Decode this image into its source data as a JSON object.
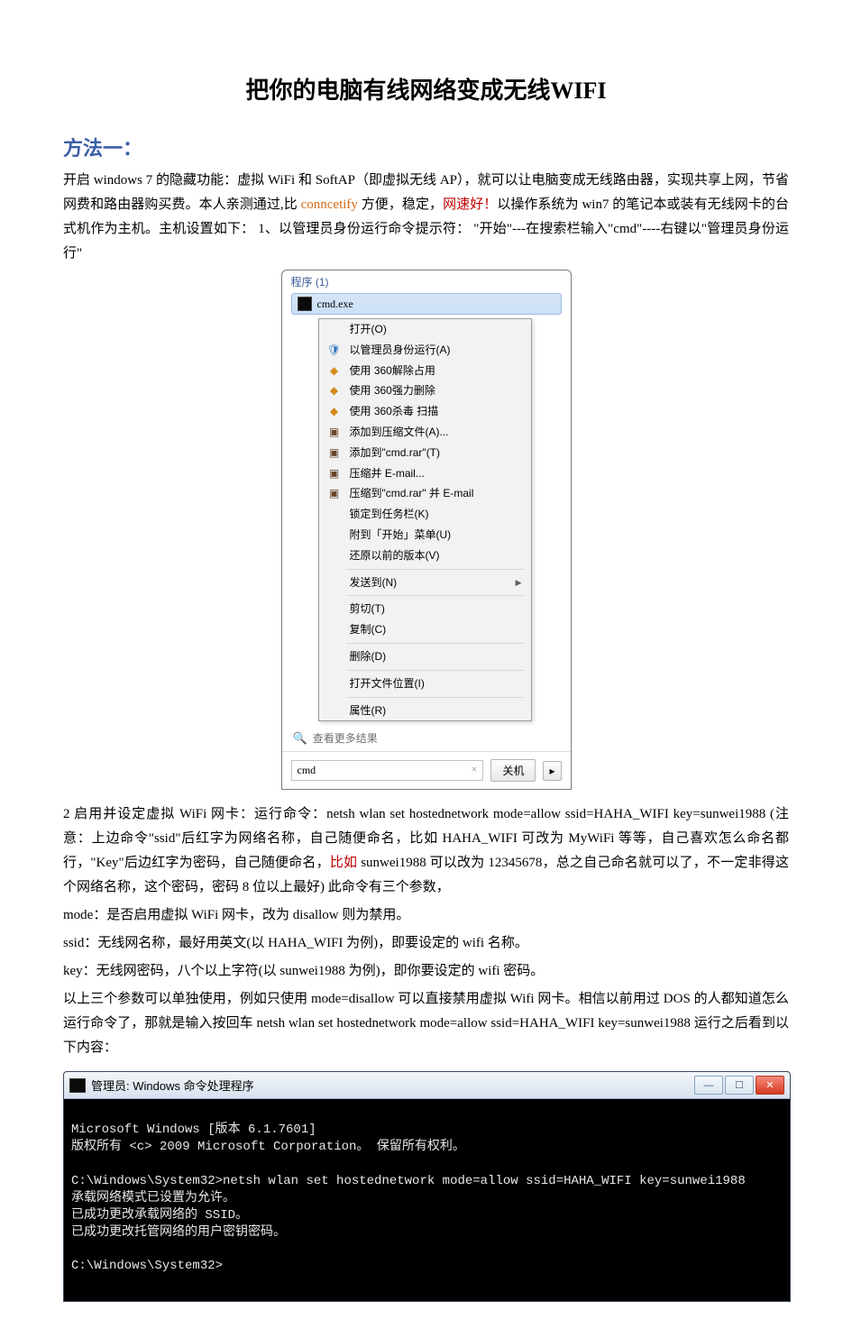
{
  "title": "把你的电脑有线网络变成无线WIFI",
  "section_heading": "方法一：",
  "para1_a": "开启 windows  7 的隐藏功能：虚拟 WiFi 和 SoftAP（即虚拟无线 AP），就可以让电脑变成无线路由器，实现共享上网，节省网费和路由器购买费。本人亲测通过,比 ",
  "para1_b": "conncetify",
  "para1_c": " 方便，稳定，",
  "para1_d": "网速好！",
  "para1_e": "以操作系统为 win7 的笔记本或装有无线网卡的台式机作为主机。主机设置如下：  1、以管理员身份运行命令提示符： \"开始\"---在搜索栏输入\"cmd\"----右键以\"管理员身份运行\"",
  "menu": {
    "header": "程序 (1)",
    "hit_label": "cmd.exe",
    "items": [
      "打开(O)",
      "以管理员身份运行(A)",
      "使用 360解除占用",
      "使用 360强力删除",
      "使用 360杀毒 扫描",
      "添加到压缩文件(A)...",
      "添加到\"cmd.rar\"(T)",
      "压缩并 E-mail...",
      "压缩到\"cmd.rar\" 并 E-mail",
      "锁定到任务栏(K)",
      "附到「开始」菜单(U)",
      "还原以前的版本(V)",
      "发送到(N)",
      "剪切(T)",
      "复制(C)",
      "删除(D)",
      "打开文件位置(I)",
      "属性(R)"
    ],
    "see_more": "查看更多结果",
    "search_value": "cmd",
    "shutdown": "关机"
  },
  "para2_a": "2 启用并设定虚拟 WiFi 网卡：运行命令：netsh  wlan  set  hostednetwork  mode=allow  ssid=HAHA_WIFI  key=sunwei1988    (注意：上边命令\"ssid\"后红字为网络名称，自己随便命名，比如 HAHA_WIFI 可改为 MyWiFi 等等，自己喜欢怎么命名都行，\"Key\"后边红字为密码，自己随便命名，",
  "para2_b": "比如",
  "para2_c": " sunwei1988 可以改为 12345678，总之自己命名就可以了，不一定非得这个网络名称，这个密码，密码 8 位以上最好)    此命令有三个参数，",
  "para3": "mode：是否启用虚拟 WiFi 网卡，改为 disallow 则为禁用。",
  "para4": "ssid：无线网名称，最好用英文(以 HAHA_WIFI 为例)，即要设定的 wifi 名称。",
  "para5": "key：无线网密码，八个以上字符(以 sunwei1988 为例)，即你要设定的 wifi 密码。",
  "para6": "以上三个参数可以单独使用，例如只使用 mode=disallow  可以直接禁用虚拟 Wifi 网卡。相信以前用过 DOS 的人都知道怎么运行命令了，那就是输入按回车 netsh  wlan  set  hostednetwork  mode=allow   ssid=HAHA_WIFI  key=sunwei1988 运行之后看到以下内容：",
  "cmd": {
    "title": "管理员: Windows 命令处理程序",
    "lines": [
      "Microsoft Windows [版本 6.1.7601]",
      "版权所有 <c> 2009 Microsoft Corporation。 保留所有权利。",
      "",
      "C:\\Windows\\System32>netsh wlan set hostednetwork mode=allow ssid=HAHA_WIFI key=sunwei1988",
      "承载网络模式已设置为允许。",
      "已成功更改承载网络的 SSID。",
      "已成功更改托管网络的用户密钥密码。",
      "",
      "C:\\Windows\\System32>"
    ]
  }
}
